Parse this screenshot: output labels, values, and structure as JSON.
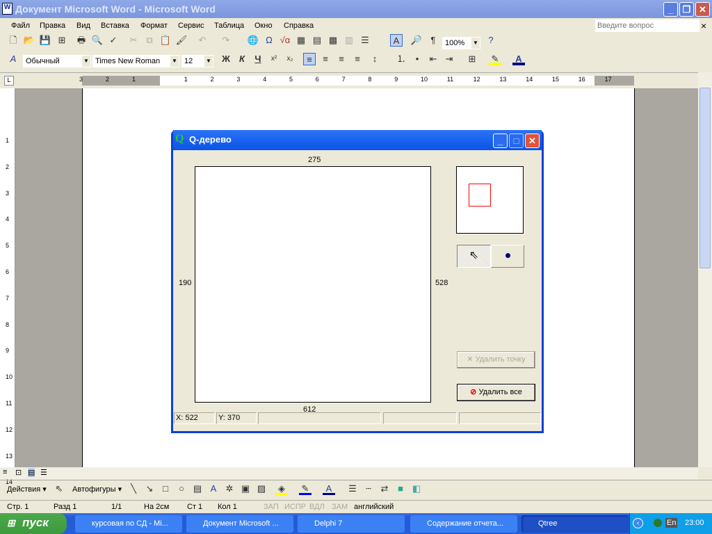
{
  "window": {
    "title": "Документ Microsoft Word - Microsoft Word",
    "minimize": "_",
    "restore": "❐",
    "close": "✕"
  },
  "menu": {
    "items": [
      "Файл",
      "Правка",
      "Вид",
      "Вставка",
      "Формат",
      "Сервис",
      "Таблица",
      "Окно",
      "Справка"
    ],
    "help_placeholder": "Введите вопрос",
    "close": "×"
  },
  "toolbar": {
    "zoom": "100%",
    "style": "Обычный",
    "font": "Times New Roman",
    "size": "12",
    "bold": "Ж",
    "italic": "К",
    "underline": "Ч"
  },
  "ruler": {
    "labels": [
      "3",
      "2",
      "1",
      "1",
      "2",
      "3",
      "4",
      "5",
      "6",
      "7",
      "8",
      "9",
      "10",
      "11",
      "12",
      "13",
      "14",
      "15",
      "16",
      "17"
    ],
    "vlabels": [
      "1",
      "2",
      "3",
      "4",
      "5",
      "6",
      "7",
      "8",
      "9",
      "10",
      "11",
      "12",
      "13",
      "14"
    ]
  },
  "dialog": {
    "title": "Q-дерево",
    "icon_letter": "Q",
    "label_top": "275",
    "label_left": "190",
    "label_right": "528",
    "label_bottom": "612",
    "delete_point": "Удалить точку",
    "delete_all": "Удалить все",
    "status": [
      "X: 522",
      "Y: 370",
      "",
      "",
      ""
    ],
    "colors": {
      "selection": "#ff0000",
      "point": "#000080"
    }
  },
  "drawing": {
    "actions": "Действия",
    "autoshapes": "Автофигуры"
  },
  "statusbar": {
    "page": "Стр. 1",
    "section": "Разд 1",
    "pages": "1/1",
    "at": "На 2см",
    "line": "Ст 1",
    "col": "Кол 1",
    "rec": "ЗАП",
    "trk": "ИСПР",
    "ext": "ВДЛ",
    "ovr": "ЗАМ",
    "lang": "английский"
  },
  "taskbar": {
    "start": "пуск",
    "tasks": [
      "курсовая по СД - Mi...",
      "Документ Microsoft ...",
      "Delphi 7",
      "Содержание отчета...",
      "Qtree"
    ],
    "lang": "En",
    "clock": "23:00"
  }
}
